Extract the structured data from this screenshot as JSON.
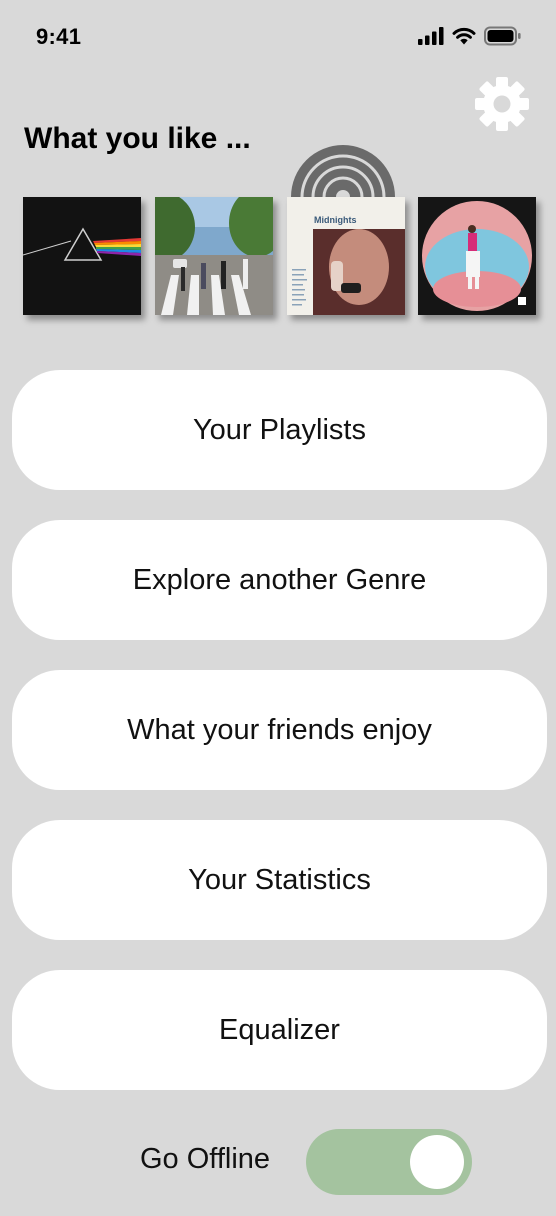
{
  "status_bar": {
    "time": "9:41",
    "icons": [
      "signal-icon",
      "wifi-icon",
      "battery-icon"
    ]
  },
  "header": {
    "settings_icon": "gear-icon"
  },
  "favorites": {
    "title": "What you like ...",
    "albums": [
      {
        "cover": "prism-album-cover"
      },
      {
        "cover": "crosswalk-album-cover"
      },
      {
        "cover": "midnights-album-cover",
        "label": "Midnights",
        "now_playing_icon": "vinyl-record-icon"
      },
      {
        "cover": "fisheye-album-cover"
      }
    ]
  },
  "menu": {
    "playlists": "Your Playlists",
    "genre": "Explore another Genre",
    "friends": "What your friends enjoy",
    "statistics": "Your Statistics",
    "equalizer": "Equalizer"
  },
  "offline": {
    "label": "Go Offline",
    "enabled": true,
    "toggle_color": "#a4c39f"
  },
  "colors": {
    "background": "#d9d9d9",
    "button": "#ffffff",
    "gear": "#ffffff"
  }
}
